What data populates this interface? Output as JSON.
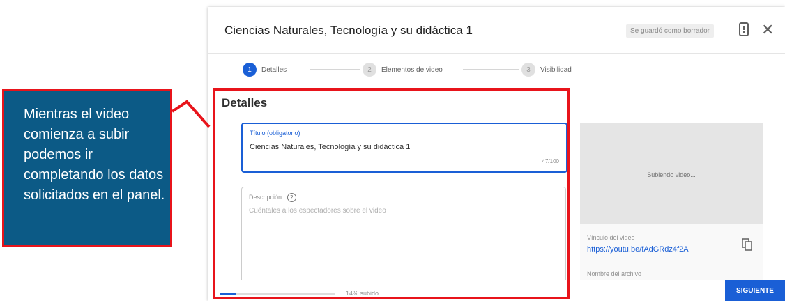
{
  "dialog": {
    "title": "Ciencias Naturales, Tecnología y su didáctica 1",
    "draft_status": "Se guardó como borrador"
  },
  "steps": [
    {
      "number": "1",
      "label": "Detalles"
    },
    {
      "number": "2",
      "label": "Elementos de video"
    },
    {
      "number": "3",
      "label": "Visibilidad"
    }
  ],
  "details": {
    "section_title": "Detalles",
    "title_field": {
      "label": "Título (obligatorio)",
      "value": "Ciencias Naturales, Tecnología y su didáctica 1",
      "counter": "47/100"
    },
    "description_field": {
      "label": "Descripción",
      "placeholder": "Cuéntales a los espectadores sobre el video"
    }
  },
  "side_panel": {
    "preview_text": "Subiendo video...",
    "link_label": "Vínculo del video",
    "link": "https://youtu.be/fAdGRdz4f2A",
    "filename_label": "Nombre del archivo"
  },
  "footer": {
    "progress": 0.14,
    "upload_text": "14% subido",
    "next_label": "SIGUIENTE"
  },
  "callout": {
    "text": "Mientras el video comienza a subir podemos ir completando los datos solicitados en el panel."
  },
  "colors": {
    "accent": "#1a5fd6",
    "highlight_border": "#e8141b",
    "callout_bg": "#0c5a86"
  }
}
